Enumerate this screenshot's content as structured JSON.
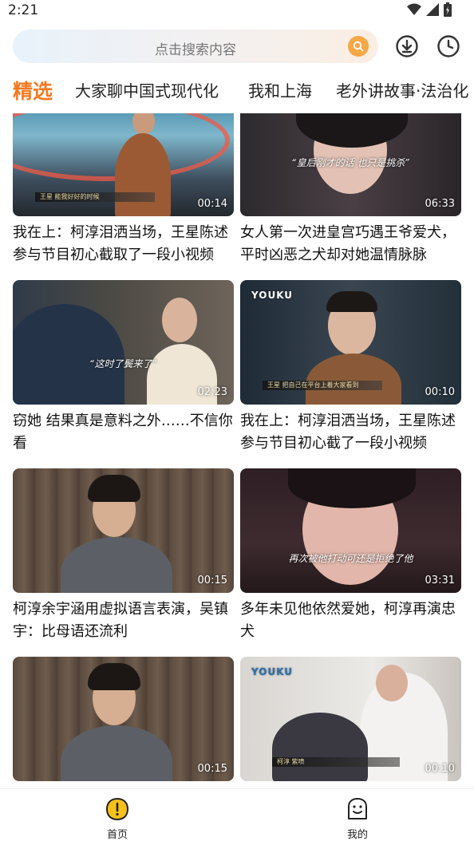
{
  "status_bar": {
    "time": "2:21",
    "icons": [
      "wifi-icon",
      "cellular-signal-icon",
      "battery-icon"
    ]
  },
  "search": {
    "placeholder": "点击搜索内容",
    "icon": "search-icon"
  },
  "top_actions": [
    {
      "name": "download-icon"
    },
    {
      "name": "history-clock-icon"
    }
  ],
  "tabs": [
    {
      "label": "精选",
      "active": true
    },
    {
      "label": "大家聊中国式现代化",
      "active": false
    },
    {
      "label": "我和上海",
      "active": false
    },
    {
      "label": "老外讲故事·法治化",
      "active": false
    }
  ],
  "videos": [
    {
      "title": "我在上：柯淳泪洒当场，王星陈述参与节目初心截取了一段小视频",
      "duration": "00:14",
      "lower_third": "王星  能我好好的时候",
      "subtitle": "",
      "logo": ""
    },
    {
      "title": "女人第一次进皇宫巧遇王爷爱犬，平时凶恶之犬却对她温情脉脉",
      "duration": "06:33",
      "lower_third": "",
      "subtitle": "“皇后刚才的话 也只是挑杀”",
      "logo": ""
    },
    {
      "title": "窃她 结果真是意料之外……不信你看",
      "duration": "02:23",
      "lower_third": "",
      "subtitle": "“这时了鬓来了”",
      "logo": ""
    },
    {
      "title": "我在上：柯淳泪洒当场，王星陈述参与节目初心截了一段小视频",
      "duration": "00:10",
      "lower_third": "王星  把自己在平台上着大家看到",
      "subtitle": "",
      "logo": "YOUKU"
    },
    {
      "title": "柯淳余宇涵用虚拟语言表演，吴镇宇：比母语还流利",
      "duration": "00:15",
      "lower_third": "",
      "subtitle": "",
      "logo": ""
    },
    {
      "title": "多年未见他依然爱她，柯淳再演忠犬",
      "duration": "03:31",
      "lower_third": "",
      "subtitle": "再次被他打动可还是拒绝了他",
      "logo": ""
    },
    {
      "title": "",
      "duration": "00:15",
      "lower_third": "",
      "subtitle": "",
      "logo": ""
    },
    {
      "title": "",
      "duration": "00:10",
      "lower_third": "柯淳  紫喷",
      "subtitle": "",
      "logo": "YOUKU"
    }
  ],
  "bottom_nav": [
    {
      "label": "首页",
      "icon": "home-exclamation-icon",
      "active": true
    },
    {
      "label": "我的",
      "icon": "profile-face-icon",
      "active": false
    }
  ],
  "colors": {
    "accent": "#f47a22",
    "search_button": "#f7a847",
    "nav_icon_active": "#f6c21a"
  }
}
